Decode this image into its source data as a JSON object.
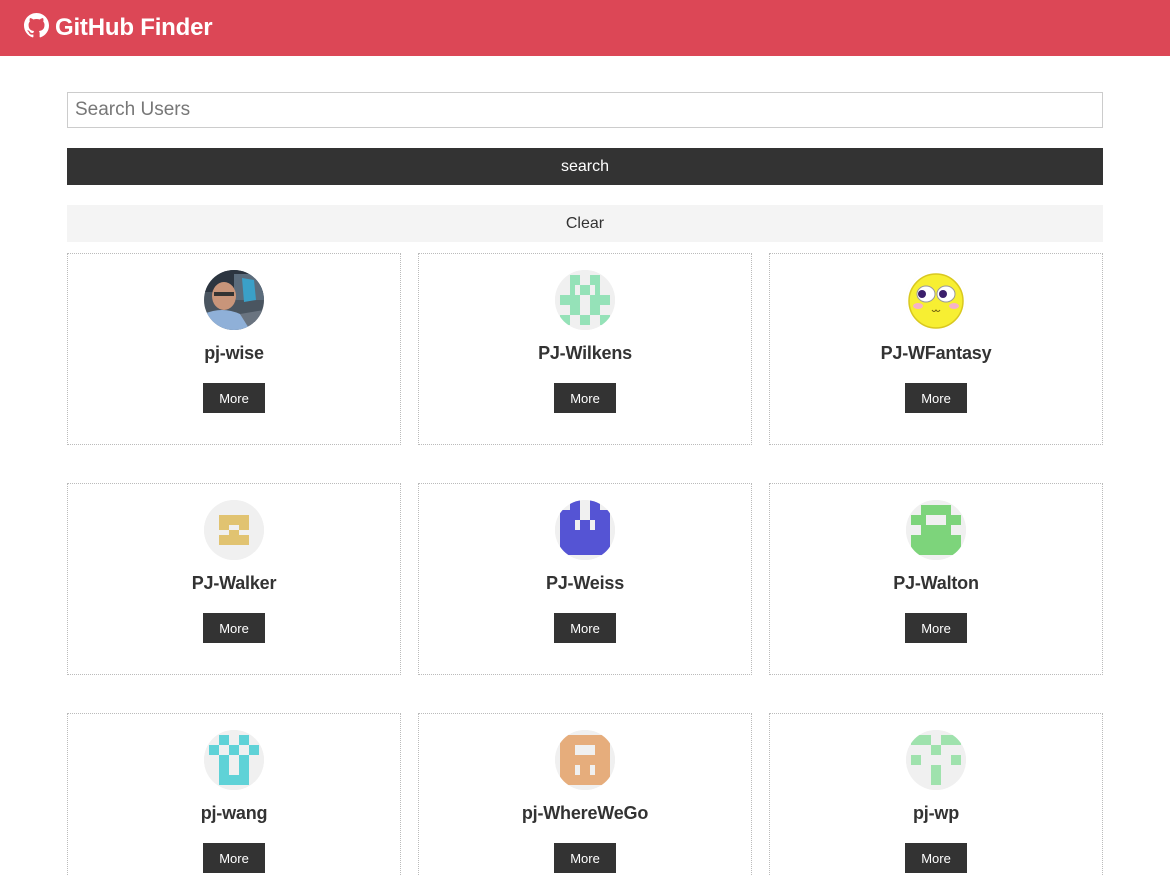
{
  "navbar": {
    "title": "GitHub Finder",
    "icon": "github-icon",
    "bg_color": "#dc4756"
  },
  "search": {
    "placeholder": "Search Users",
    "value": ""
  },
  "buttons": {
    "search_label": "search",
    "clear_label": "Clear"
  },
  "users": [
    {
      "login": "pj-wise",
      "more_label": "More",
      "avatar": "photo"
    },
    {
      "login": "PJ-Wilkens",
      "more_label": "More",
      "avatar": "identicon",
      "color": "#95e2b8"
    },
    {
      "login": "PJ-WFantasy",
      "more_label": "More",
      "avatar": "emoji"
    },
    {
      "login": "PJ-Walker",
      "more_label": "More",
      "avatar": "identicon",
      "color": "#e1c371"
    },
    {
      "login": "PJ-Weiss",
      "more_label": "More",
      "avatar": "identicon",
      "color": "#5554d4"
    },
    {
      "login": "PJ-Walton",
      "more_label": "More",
      "avatar": "identicon",
      "color": "#7dd47b"
    },
    {
      "login": "pj-wang",
      "more_label": "More",
      "avatar": "identicon",
      "color": "#5fd2d7"
    },
    {
      "login": "pj-WhereWeGo",
      "more_label": "More",
      "avatar": "identicon",
      "color": "#e6ad7c"
    },
    {
      "login": "pj-wp",
      "more_label": "More",
      "avatar": "identicon",
      "color": "#9fe2ad"
    }
  ]
}
